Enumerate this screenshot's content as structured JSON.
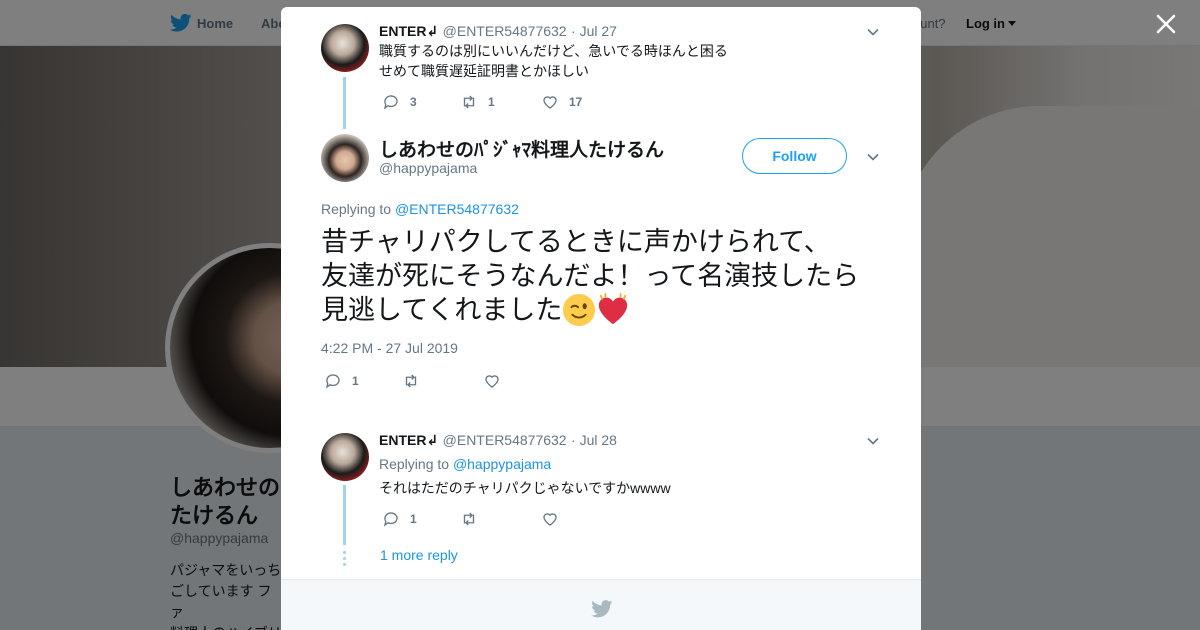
{
  "nav": {
    "home_label": "Home",
    "about_label": "Abo",
    "account_text": "ccount?",
    "login_label": "Log in"
  },
  "profile": {
    "name": "しあわせの\nたけるん",
    "handle": "@happypajama",
    "bio": "パジャマをいっち\nごしています ファ\n料理人のハイブリ\nらたちごがすきで"
  },
  "tweets": [
    {
      "author": "ENTER↲",
      "handle": "@ENTER54877632",
      "date": "· Jul 27",
      "lines": [
        "職質するのは別にいいんだけど、急いでる時ほんと困る",
        "せめて職質遅延証明書とかほしい"
      ],
      "replies": "3",
      "retweets": "1",
      "likes": "17"
    }
  ],
  "main_tweet": {
    "author": "しあわせのﾊﾟｼﾞｬﾏ料理人たけるん",
    "handle": "@happypajama",
    "follow_label": "Follow",
    "replying_prefix": "Replying to",
    "replying_to": "@ENTER54877632",
    "text_lines": [
      "昔チャリパクしてるときに声かけられて、",
      "友達が死にそうなんだよ！って名演技したら",
      "見逃してくれました"
    ],
    "timestamp": "4:22 PM - 27 Jul 2019",
    "replies": "1",
    "retweets": "",
    "likes": ""
  },
  "reply": {
    "author": "ENTER↲",
    "handle": "@ENTER54877632",
    "date": "· Jul 28",
    "replying_prefix": "Replying to",
    "replying_to": "@happypajama",
    "text": "それはただのチャリパクじゃないですかwwww",
    "replies": "1",
    "retweets": "",
    "likes": ""
  },
  "more_replies": "1 more reply",
  "colors": {
    "brand": "#1da1f2",
    "link": "#1b95e0",
    "muted": "#657786",
    "thread": "#9fd2f4"
  },
  "icons": [
    "twitter-bird-icon",
    "close-icon",
    "chevron-down-icon",
    "reply-icon",
    "retweet-icon",
    "heart-icon",
    "wink-emoji-icon",
    "sparkling-heart-emoji-icon"
  ]
}
